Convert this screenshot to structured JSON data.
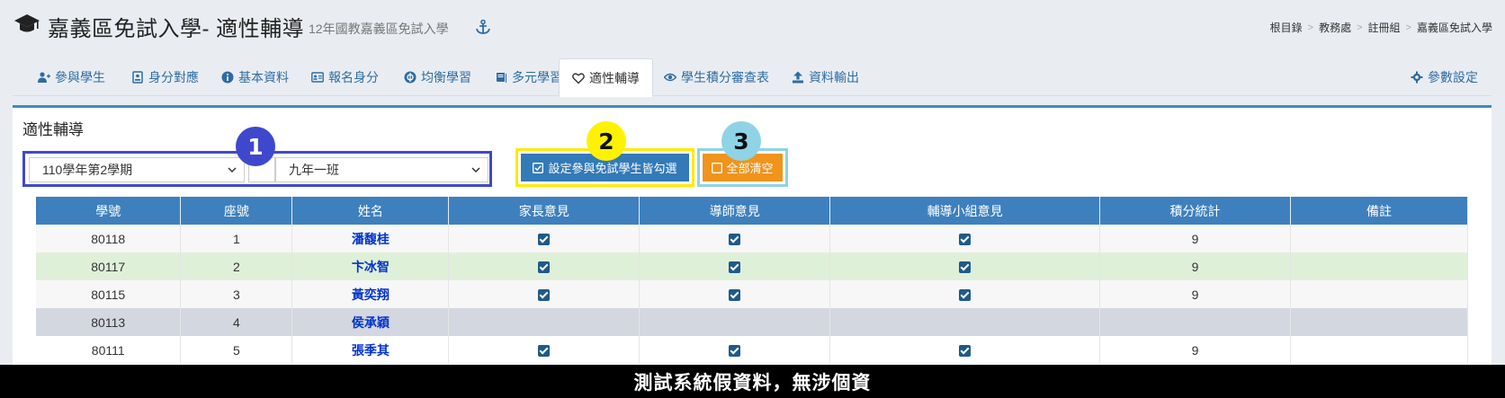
{
  "header": {
    "title": "嘉義區免試入學- 適性輔導",
    "subtitle": "12年國教嘉義區免試入學",
    "breadcrumb": [
      "根目錄",
      "教務處",
      "註冊組",
      "嘉義區免試入學"
    ]
  },
  "tabs": [
    {
      "label": "參與學生",
      "icon": "users-plus-icon"
    },
    {
      "label": "身分對應",
      "icon": "id-card-icon"
    },
    {
      "label": "基本資料",
      "icon": "info-circle-icon"
    },
    {
      "label": "報名身分",
      "icon": "address-card-icon"
    },
    {
      "label": "均衡學習",
      "icon": "balance-icon"
    },
    {
      "label": "多元學習",
      "icon": "book-icon"
    },
    {
      "label": "適性輔導",
      "icon": "heart-icon",
      "active": true
    },
    {
      "label": "學生積分審查表",
      "icon": "eye-icon"
    },
    {
      "label": "資料輸出",
      "icon": "upload-icon"
    },
    {
      "label": "參數設定",
      "icon": "gear-icon"
    }
  ],
  "panel": {
    "title": "適性輔導",
    "semester_select": "110學年第2學期",
    "class_select": "九年一班",
    "set_button": "設定參與免試學生皆勾選",
    "clear_button": "全部清空",
    "badges": [
      "1",
      "2",
      "3"
    ]
  },
  "table": {
    "columns": [
      "學號",
      "座號",
      "姓名",
      "家長意見",
      "導師意見",
      "輔導小組意見",
      "積分統計",
      "備註"
    ],
    "rows": [
      {
        "id": "80118",
        "seat": "1",
        "name": "潘馥桂",
        "parent": true,
        "teacher": true,
        "counsel": true,
        "score": "9",
        "note": ""
      },
      {
        "id": "80117",
        "seat": "2",
        "name": "卞冰智",
        "parent": true,
        "teacher": true,
        "counsel": true,
        "score": "9",
        "note": ""
      },
      {
        "id": "80115",
        "seat": "3",
        "name": "黃奕翔",
        "parent": true,
        "teacher": true,
        "counsel": true,
        "score": "9",
        "note": ""
      },
      {
        "id": "80113",
        "seat": "4",
        "name": "侯承穎",
        "parent": false,
        "teacher": false,
        "counsel": false,
        "score": "",
        "note": ""
      },
      {
        "id": "80111",
        "seat": "5",
        "name": "張季其",
        "parent": true,
        "teacher": true,
        "counsel": true,
        "score": "9",
        "note": ""
      }
    ]
  },
  "footer": {
    "banner": "測試系統假資料，無涉個資"
  },
  "colors": {
    "primary": "#337ab7",
    "table_header": "#3e80bd",
    "warning": "#f0941c",
    "highlight_blue": "#3f48cc",
    "highlight_yellow": "#fff200",
    "highlight_cyan": "#8fd3e6"
  }
}
